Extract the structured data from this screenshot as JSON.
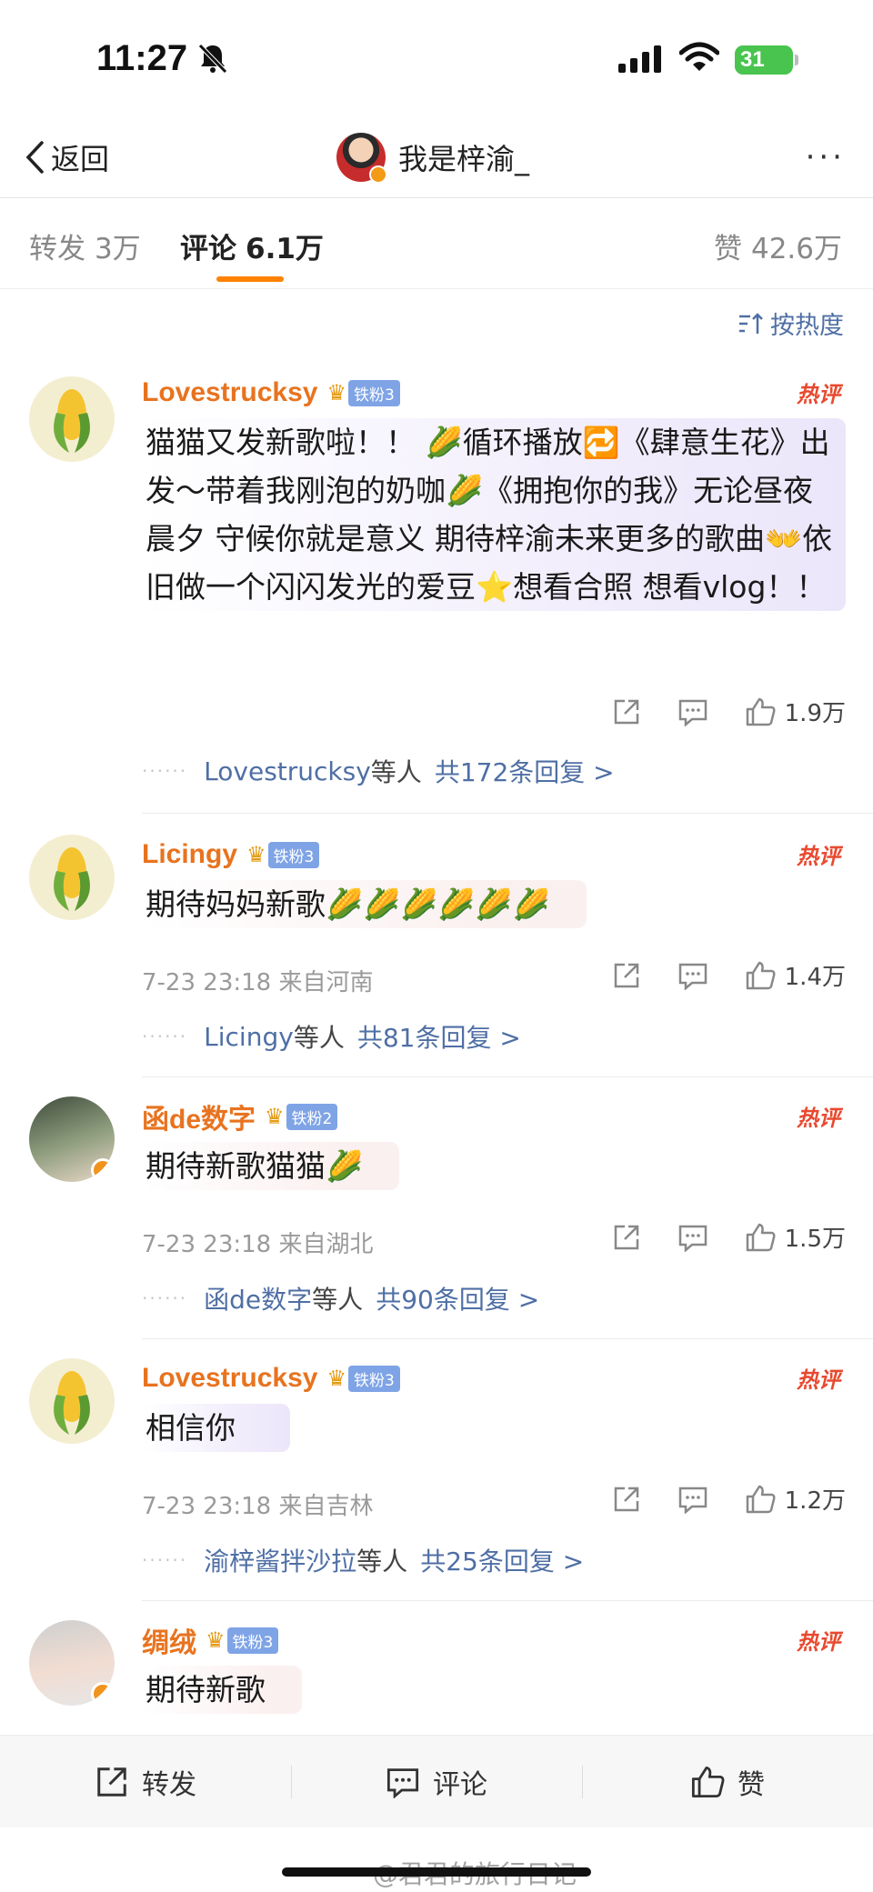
{
  "status": {
    "time": "11:27",
    "battery": "31"
  },
  "nav": {
    "back_label": "返回",
    "title": "我是梓渝_",
    "more": "···"
  },
  "tabs": [
    {
      "label": "转发",
      "count": "3万"
    },
    {
      "label": "评论",
      "count": "6.1万"
    },
    {
      "label": "赞",
      "count": "42.6万"
    }
  ],
  "sort_label": "按热度",
  "comments": [
    {
      "user": "Lovestrucksy",
      "fan": "铁粉3",
      "hot": "热评",
      "text": "猫猫又发新歌啦！！ 🌽循环播放🔁《肆意生花》出发～带着我刚泡的奶咖🌽《拥抱你的我》无论昼夜晨夕 守候你就是意义 期待梓渝未来更多的歌曲👐依旧做一个闪闪发光的爱豆⭐想看合照 想看vlog！！",
      "time": "",
      "likes": "1.9万",
      "reply_user": "Lovestrucksy",
      "reply_mid": "等人",
      "reply_total": "共172条回复 >"
    },
    {
      "user": "Licingy",
      "fan": "铁粉3",
      "hot": "热评",
      "text": "期待妈妈新歌🌽🌽🌽🌽🌽🌽",
      "time": "7-23 23:18 来自河南",
      "likes": "1.4万",
      "reply_user": "Licingy",
      "reply_mid": "等人",
      "reply_total": "共81条回复 >"
    },
    {
      "user": "函de数字",
      "fan": "铁粉2",
      "hot": "热评",
      "text": "期待新歌猫猫🌽",
      "time": "7-23 23:18 来自湖北",
      "likes": "1.5万",
      "reply_user": "函de数字",
      "reply_mid": "等人",
      "reply_total": "共90条回复 >"
    },
    {
      "user": "Lovestrucksy",
      "fan": "铁粉3",
      "hot": "热评",
      "text": "相信你",
      "time": "7-23 23:18 来自吉林",
      "likes": "1.2万",
      "reply_user": "渝梓酱拌沙拉",
      "reply_mid": "等人",
      "reply_total": "共25条回复 >"
    },
    {
      "user": "绸绒",
      "fan": "铁粉3",
      "hot": "热评",
      "text": "期待新歌"
    }
  ],
  "bottom": {
    "repost": "转发",
    "comment": "评论",
    "like": "赞"
  },
  "watermark": "@君君的旅行日记",
  "colors": {
    "accent": "#ff8200",
    "username": "#e8731f",
    "link": "#4f6fa5",
    "hot": "#e8492f"
  }
}
